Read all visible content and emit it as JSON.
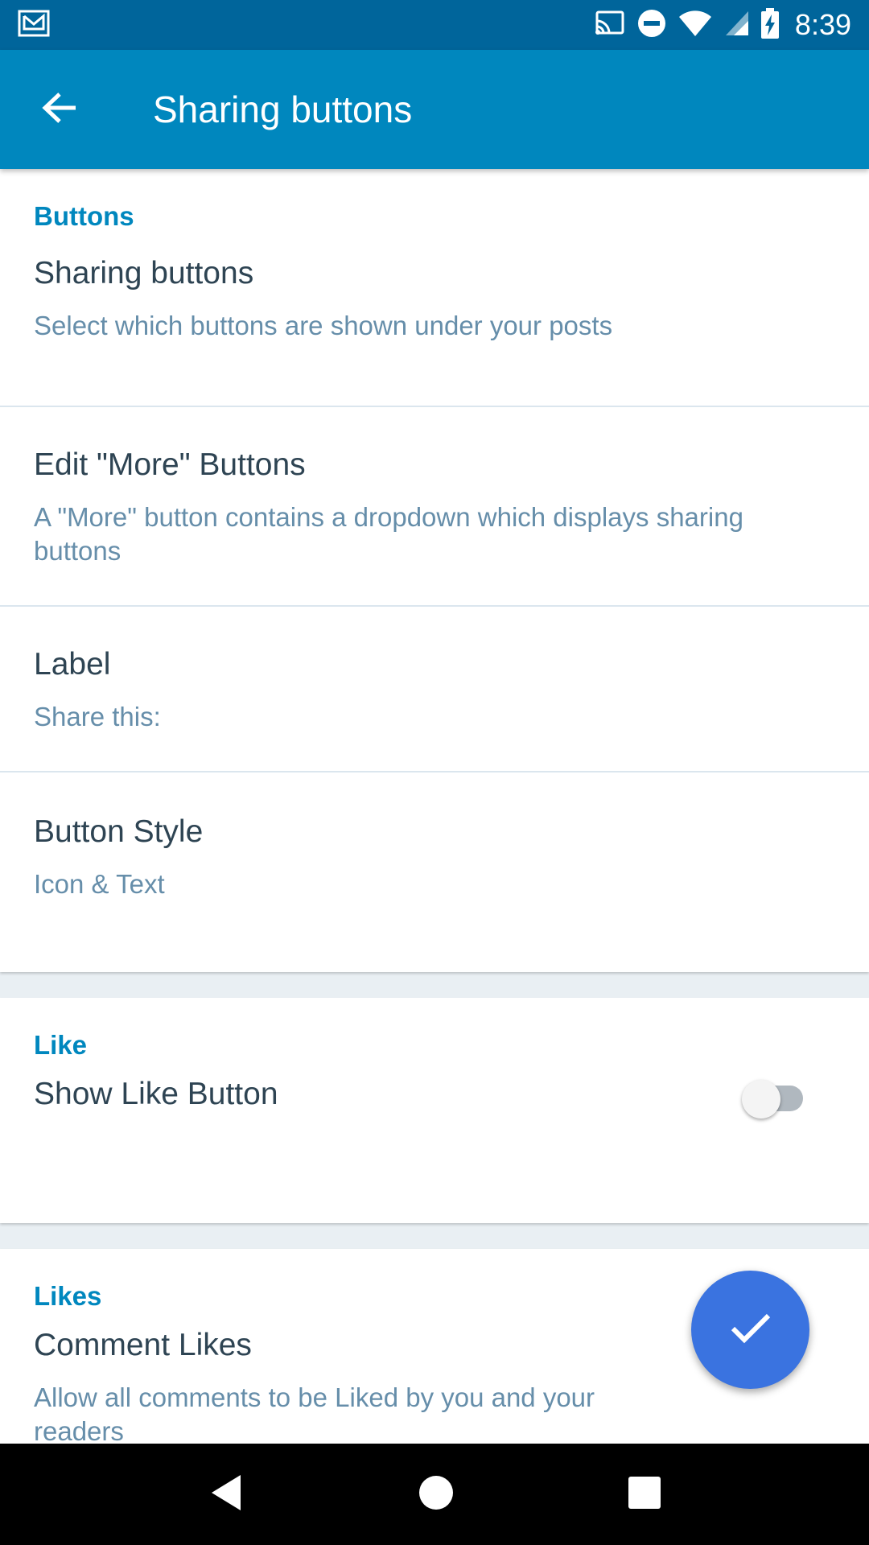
{
  "status_bar": {
    "time": "8:39",
    "icons": [
      "gmail-icon",
      "cast-icon",
      "do-not-disturb-icon",
      "wifi-icon",
      "signal-icon",
      "battery-charging-icon"
    ]
  },
  "app_bar": {
    "title": "Sharing buttons",
    "back_icon": "arrow-back-icon"
  },
  "sections": {
    "buttons": {
      "title": "Buttons",
      "sharing_buttons": {
        "title": "Sharing buttons",
        "summary": "Select which buttons are shown under your posts"
      },
      "edit_more": {
        "title": "Edit \"More\" Buttons",
        "summary": "A \"More\" button contains a dropdown which displays sharing buttons"
      },
      "label": {
        "title": "Label",
        "summary": "Share this:"
      },
      "button_style": {
        "title": "Button Style",
        "summary": "Icon & Text"
      }
    },
    "like": {
      "title": "Like",
      "show_like": {
        "title": "Show Like Button",
        "enabled": false
      }
    },
    "likes": {
      "title": "Likes",
      "comment_likes": {
        "title": "Comment Likes",
        "summary": "Allow all comments to be Liked by you and your readers",
        "enabled": false
      }
    }
  },
  "fab": {
    "icon": "check-icon"
  },
  "colors": {
    "status_bar": "#00659b",
    "app_bar": "#0087be",
    "accent": "#0087be",
    "fab": "#3a73e0",
    "title_text": "#2e4453",
    "summary_text": "#668eaa"
  },
  "nav_bar": {
    "icons": [
      "back-triangle-icon",
      "home-circle-icon",
      "recents-square-icon"
    ]
  }
}
